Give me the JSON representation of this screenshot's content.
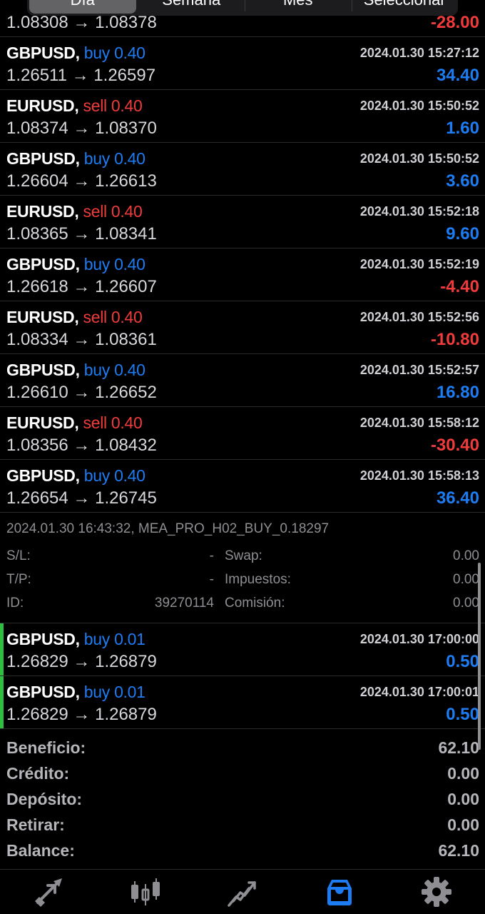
{
  "segments": [
    {
      "label": "Día",
      "active": true
    },
    {
      "label": "Semana",
      "active": false
    },
    {
      "label": "Mes",
      "active": false
    },
    {
      "label": "Seleccionar",
      "active": false
    }
  ],
  "partial_deal": {
    "prices": "1.08308 → 1.08378",
    "profit": "-28.00"
  },
  "deals": [
    {
      "symbol": "GBPUSD,",
      "direction": "buy 0.40",
      "side": "buy",
      "time": "2024.01.30 15:27:12",
      "prices": "1.26511 → 1.26597",
      "profit": "34.40"
    },
    {
      "symbol": "EURUSD,",
      "direction": "sell 0.40",
      "side": "sell",
      "time": "2024.01.30 15:50:52",
      "prices": "1.08374 → 1.08370",
      "profit": "1.60"
    },
    {
      "symbol": "GBPUSD,",
      "direction": "buy 0.40",
      "side": "buy",
      "time": "2024.01.30 15:50:52",
      "prices": "1.26604 → 1.26613",
      "profit": "3.60"
    },
    {
      "symbol": "EURUSD,",
      "direction": "sell 0.40",
      "side": "sell",
      "time": "2024.01.30 15:52:18",
      "prices": "1.08365 → 1.08341",
      "profit": "9.60"
    },
    {
      "symbol": "GBPUSD,",
      "direction": "buy 0.40",
      "side": "buy",
      "time": "2024.01.30 15:52:19",
      "prices": "1.26618 → 1.26607",
      "profit": "-4.40"
    },
    {
      "symbol": "EURUSD,",
      "direction": "sell 0.40",
      "side": "sell",
      "time": "2024.01.30 15:52:56",
      "prices": "1.08334 → 1.08361",
      "profit": "-10.80"
    },
    {
      "symbol": "GBPUSD,",
      "direction": "buy 0.40",
      "side": "buy",
      "time": "2024.01.30 15:52:57",
      "prices": "1.26610 → 1.26652",
      "profit": "16.80"
    },
    {
      "symbol": "EURUSD,",
      "direction": "sell 0.40",
      "side": "sell",
      "time": "2024.01.30 15:58:12",
      "prices": "1.08356 → 1.08432",
      "profit": "-30.40"
    },
    {
      "symbol": "GBPUSD,",
      "direction": "buy 0.40",
      "side": "buy",
      "time": "2024.01.30 15:58:13",
      "prices": "1.26654 → 1.26745",
      "profit": "36.40"
    }
  ],
  "detail": {
    "comment": "2024.01.30 16:43:32, MEA_PRO_H02_BUY_0.18297",
    "sl_label": "S/L:",
    "sl_value": "-",
    "tp_label": "T/P:",
    "tp_value": "-",
    "id_label": "ID:",
    "id_value": "39270114",
    "swap_label": "Swap:",
    "swap_value": "0.00",
    "tax_label": "Impuestos:",
    "tax_value": "0.00",
    "commission_label": "Comisión:",
    "commission_value": "0.00"
  },
  "open_deals": [
    {
      "symbol": "GBPUSD,",
      "direction": "buy 0.01",
      "side": "buy",
      "time": "2024.01.30 17:00:00",
      "prices": "1.26829 → 1.26879",
      "profit": "0.50"
    },
    {
      "symbol": "GBPUSD,",
      "direction": "buy 0.01",
      "side": "buy",
      "time": "2024.01.30 17:00:01",
      "prices": "1.26829 → 1.26879",
      "profit": "0.50"
    }
  ],
  "summary": [
    {
      "label": "Beneficio:",
      "value": "62.10"
    },
    {
      "label": "Crédito:",
      "value": "0.00"
    },
    {
      "label": "Depósito:",
      "value": "0.00"
    },
    {
      "label": "Retirar:",
      "value": "0.00"
    },
    {
      "label": "Balance:",
      "value": "62.10"
    }
  ],
  "tabs": [
    {
      "name": "quotes-tab",
      "icon": "arrows-icon",
      "active": false
    },
    {
      "name": "chart-tab",
      "icon": "candlestick-icon",
      "active": false
    },
    {
      "name": "trade-tab",
      "icon": "trend-icon",
      "active": false
    },
    {
      "name": "history-tab",
      "icon": "inbox-icon",
      "active": true
    },
    {
      "name": "settings-tab",
      "icon": "gear-icon",
      "active": false
    }
  ],
  "colors": {
    "buy": "#1e7cf2",
    "sell": "#ef3b3b",
    "active_tab": "#1e7cf2",
    "inactive_tab": "#8e8e93",
    "marker": "#2fbe3f"
  }
}
